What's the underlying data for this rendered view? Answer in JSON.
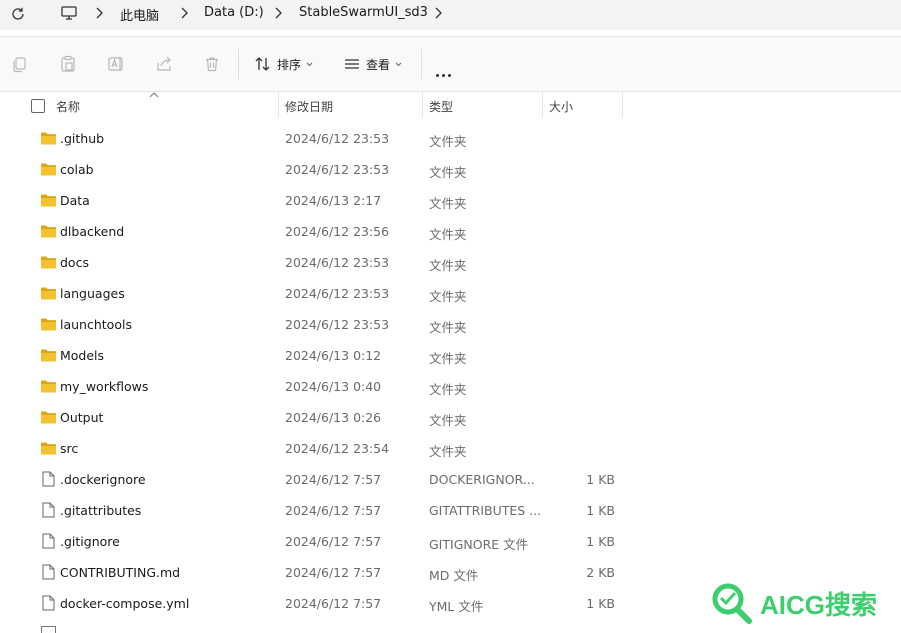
{
  "breadcrumb": {
    "items": [
      "此电脑",
      "Data (D:)",
      "StableSwarmUI_sd3"
    ]
  },
  "toolbar": {
    "sort_label": "排序",
    "view_label": "查看"
  },
  "columns": {
    "name": "名称",
    "modified": "修改日期",
    "type": "类型",
    "size": "大小"
  },
  "files": [
    {
      "name": ".github",
      "date": "2024/6/12 23:53",
      "type": "文件夹",
      "size": "",
      "kind": "folder"
    },
    {
      "name": "colab",
      "date": "2024/6/12 23:53",
      "type": "文件夹",
      "size": "",
      "kind": "folder"
    },
    {
      "name": "Data",
      "date": "2024/6/13 2:17",
      "type": "文件夹",
      "size": "",
      "kind": "folder"
    },
    {
      "name": "dlbackend",
      "date": "2024/6/12 23:56",
      "type": "文件夹",
      "size": "",
      "kind": "folder"
    },
    {
      "name": "docs",
      "date": "2024/6/12 23:53",
      "type": "文件夹",
      "size": "",
      "kind": "folder"
    },
    {
      "name": "languages",
      "date": "2024/6/12 23:53",
      "type": "文件夹",
      "size": "",
      "kind": "folder"
    },
    {
      "name": "launchtools",
      "date": "2024/6/12 23:53",
      "type": "文件夹",
      "size": "",
      "kind": "folder"
    },
    {
      "name": "Models",
      "date": "2024/6/13 0:12",
      "type": "文件夹",
      "size": "",
      "kind": "folder"
    },
    {
      "name": "my_workflows",
      "date": "2024/6/13 0:40",
      "type": "文件夹",
      "size": "",
      "kind": "folder"
    },
    {
      "name": "Output",
      "date": "2024/6/13 0:26",
      "type": "文件夹",
      "size": "",
      "kind": "folder"
    },
    {
      "name": "src",
      "date": "2024/6/12 23:54",
      "type": "文件夹",
      "size": "",
      "kind": "folder"
    },
    {
      "name": ".dockerignore",
      "date": "2024/6/12 7:57",
      "type": "DOCKERIGNOR...",
      "size": "1 KB",
      "kind": "file"
    },
    {
      "name": ".gitattributes",
      "date": "2024/6/12 7:57",
      "type": "GITATTRIBUTES ...",
      "size": "1 KB",
      "kind": "file"
    },
    {
      "name": ".gitignore",
      "date": "2024/6/12 7:57",
      "type": "GITIGNORE 文件",
      "size": "1 KB",
      "kind": "file"
    },
    {
      "name": "CONTRIBUTING.md",
      "date": "2024/6/12 7:57",
      "type": "MD 文件",
      "size": "2 KB",
      "kind": "file"
    },
    {
      "name": "docker-compose.yml",
      "date": "2024/6/12 7:57",
      "type": "YML 文件",
      "size": "1 KB",
      "kind": "file"
    }
  ],
  "watermark": {
    "text": "AICG搜索"
  },
  "colors": {
    "folder": "#f2c230",
    "folder_dark": "#dba515",
    "watermark": "#3dcf6e",
    "accent": "#1a1a1a"
  },
  "icons": [
    "refresh-icon",
    "this-pc-icon",
    "chevron-right-icon",
    "copy-icon",
    "paste-icon",
    "rename-icon",
    "share-icon",
    "delete-icon",
    "sort-icon",
    "view-icon",
    "more-icon",
    "folder-icon",
    "file-icon"
  ]
}
